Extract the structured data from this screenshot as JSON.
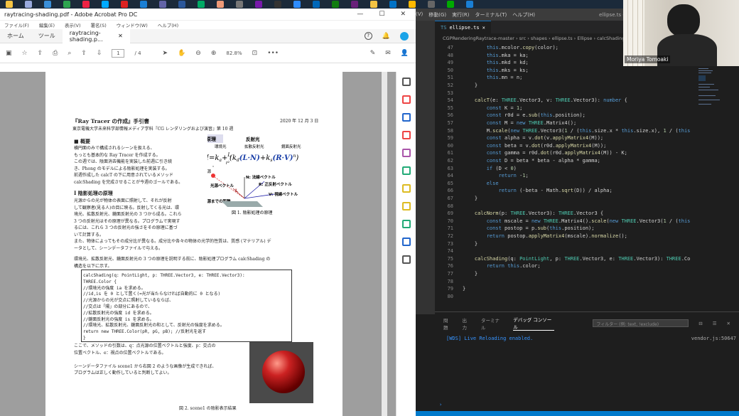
{
  "taskbar": {
    "icons": [
      "folder-icon",
      "search-icon",
      "store-icon",
      "edge-icon",
      "chrome-icon",
      "mail-icon",
      "acrobat-icon",
      "vscode-icon",
      "teams-icon",
      "word-icon",
      "calendar-icon",
      "photos-icon",
      "settings-icon",
      "onenote-icon",
      "terminal-icon",
      "zoom-icon",
      "store-icon",
      "xbox-icon",
      "vs-icon",
      "explorer-icon",
      "outlook-icon",
      "notes-icon",
      "camera-icon",
      "maps-icon",
      "app-icon"
    ],
    "colors": [
      "#f5c443",
      "#9ad",
      "#3a8fd9",
      "#2ea44f",
      "#e24",
      "#0af",
      "#d22",
      "#1a7fd4",
      "#6264a7",
      "#2b579a",
      "#0a6",
      "#e97",
      "#777",
      "#7719aa",
      "#333",
      "#2d8cff",
      "#0067b8",
      "#107c10",
      "#68217a",
      "#f5c443",
      "#0072c6",
      "#ffb900",
      "#666",
      "#0a0",
      "#1a7fd4"
    ]
  },
  "acrobat": {
    "window_title": "raytracing-shading.pdf - Adobe Acrobat Pro DC",
    "menu": [
      "ファイル(F)",
      "編集(E)",
      "表示(V)",
      "署名(S)",
      "ウィンドウ(W)",
      "ヘルプ(H)"
    ],
    "tabs": {
      "home": "ホーム",
      "tools": "ツール",
      "doc": "raytracing-shading.p..."
    },
    "page_current": "1",
    "page_total": "/ 4",
    "zoom": "82.8%"
  },
  "document": {
    "title": "『Ray Tracer の作成』手引書",
    "date": "2020 年 12 月 3 日",
    "affiliation": "東京電機大学未来科学部情報メディア学科『CG レンダリングおよび演習』第 10 週",
    "sec_overview": "■ 概要",
    "overview_lines": [
      "横円面のみで構成されるシーンを扱える、",
      "もっとも基本的な Ray Tracer を作成する。",
      "この週では、陰面消去機能を実装した前週に引き続",
      "き、Phong のモデルによる陰影処理を実装する。",
      "前週作成した calcT の下に用意されているメソッド",
      "calcShading を完成させることが今週のゴールである。"
    ],
    "sec1": "Ⅰ 陰影処理の原理",
    "sec1_lines": [
      "光源からの光が物体の表面に照射して、それが反射",
      "して観察者(見る人)の目に映る。反射してくる光は、環",
      "境光、拡散反射光、鏡面反射光の 3 つから成る。これら",
      "3 つの反射光はその原理が異なる。プログラムで実現す",
      "るには、これら 3 つの反射光の強さをその原理に基づ",
      "いて計算する。",
      "また、物体によってもその成分比が異なる。成分比や各々の物体の光学的性質は、質感 (マテリアル) デ",
      "ータとして、シーンデータファイルで与える。"
    ],
    "para2": [
      "環境光、拡散反射光、鏡面反射光の 3 つの原理を説明する前に、陰影処理プログラム calcShading の",
      "構造を以下に示す。"
    ],
    "code_lines": [
      "calcShading(q: PointLight, p: THREE.Vector3, e: THREE.Vector3):",
      "THREE.Color {",
      "    //環境光の強度 ia を求める。",
      "    //id,is を 0 として置く(=光が当たらなければ自動的に 0 となる)",
      "    //光源からの光が交点に照射しているならば、",
      "        //交点は「陽」の部分にあるので、",
      "        //拡散反射光の強度 id を求める。",
      "        //鏡面反射光の強度 is を求める。",
      "    //環境光、拡散反射光、鏡面反射光の和として、反射光の強度を求める。",
      "    return new THREE.Color(pR, pG, pB);  //反射光を返す",
      "}"
    ],
    "after_code": [
      "ここで、メソッドの引数は、q：点光源の位置ベクトルと強度、p：交点の",
      "位置ベクトル、e：視点の位置ベクトルである。",
      "",
      "シーンデータファイル scene1 から右図 2 のような画像が生成できれば、",
      "プログラムは正しく動作していると判断してよい。"
    ],
    "fig1_caption": "図 1. 陰影処理の原理",
    "fig2_caption": "図 2. scene1 の陰影表示結果",
    "formula": {
      "label_principle": "原理",
      "label_reflect": "反射光",
      "label_ambient": "環境光",
      "label_diffuse": "拡散反射光",
      "label_specular": "鏡面反射光",
      "equation": "I=k_a + I_s/r²(k_d(L·N)+k_s(R·V)ⁿ)",
      "eq_I": "I=k",
      "eq_a": "a",
      "eq_plus": "+",
      "eq_frac_num": "I",
      "eq_frac_s": "s",
      "eq_frac_den": "r²",
      "eq_d_k": "(k",
      "eq_d_sub": "d",
      "eq_d_term": "(L·N)",
      "eq_s_plus": "+k",
      "eq_s_sub": "s",
      "eq_s_term": "(R·V)",
      "eq_n": "n",
      "eq_close": ")",
      "light_source": "光源",
      "light_vec": "光源ベクトル",
      "normal": "N: 法線ベクトル",
      "reflect_vec": "R: 正反射ベクトル",
      "view_vec": "V: 視線ベクトル",
      "distance": "光源までの距離",
      "L": "L"
    }
  },
  "vscode": {
    "menu": [
      "(V)",
      "移動(G)",
      "実行(R)",
      "ターミナル(T)",
      "ヘルプ(H)"
    ],
    "window_title": "ellipse.ts - cgrs (ワークスペース) - Visual Studio Code",
    "tab": "ellipse.ts",
    "breadcrumb": [
      "CGPRenderingRaytrace-master",
      "src",
      "shapes",
      "ellipse.ts",
      "Ellipse",
      "calcShading"
    ],
    "line_numbers": [
      "47",
      "48",
      "49",
      "50",
      "51",
      "52",
      "53",
      "54",
      "55",
      "56",
      "57",
      "58",
      "59",
      "60",
      "61",
      "62",
      "63",
      "64",
      "65",
      "66",
      "67",
      "68",
      "69",
      "70",
      "71",
      "72",
      "73",
      "74",
      "75",
      "76",
      "77",
      "78",
      "79",
      "80"
    ],
    "code_lines": [
      "        this.mcolor.copy(color);",
      "        this.mka = ka;",
      "        this.mkd = kd;",
      "        this.mks = ks;",
      "        this.mn = n;",
      "    }",
      "",
      "    calcT(e: THREE.Vector3, v: THREE.Vector3): number {",
      "        const K = 1;",
      "        const r0d = e.sub(this.position);",
      "        const M = new THREE.Matrix4();",
      "        M.scale(new THREE.Vector3(1 / (this.size.x * this.size.x), 1 / (this",
      "        const alpha = v.dot(v.applyMatrix4(M));",
      "        const beta = v.dot(r0d.applyMatrix4(M));",
      "        const gamma = r0d.dot(r0d.applyMatrix4(M)) - K;",
      "        const D = beta * beta - alpha * gamma;",
      "        if (D < 0)",
      "            return -1;",
      "        else",
      "            return (-beta - Math.sqrt(D)) / alpha;",
      "    }",
      "",
      "    calcNorm(p: THREE.Vector3): THREE.Vector3 {",
      "        const mscale = new THREE.Matrix4().scale(new THREE.Vector3(1 / (this",
      "        const postop = p.sub(this.position);",
      "        return postop.applyMatrix4(mscale).normalize();",
      "    }",
      "",
      "    calcShading(q: PointLight, p: THREE.Vector3, e: THREE.Vector3): THREE.Co",
      "        return this.color;",
      "    }",
      "",
      "}",
      ""
    ],
    "panel_tabs": [
      "問題",
      "出力",
      "ターミナル",
      "デバッグ コンソール"
    ],
    "filter_placeholder": "フィルター (例: text, !exclude)",
    "console_line": "[WDS] Live Reloading enabled.",
    "console_source": "vendor.js:50647"
  },
  "webcam": {
    "name": "Moriya Tomoaki"
  }
}
